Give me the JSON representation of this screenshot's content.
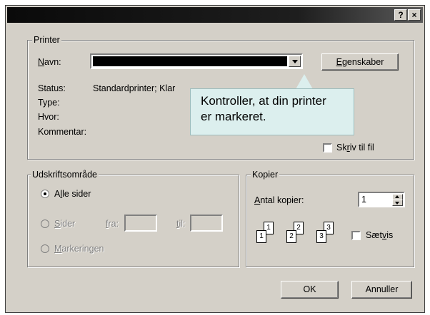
{
  "title_bar": {
    "help": "?",
    "close": "×"
  },
  "printer": {
    "group_label": "Printer",
    "name_label_pre": "",
    "name_label_u": "N",
    "name_label_post": "avn:",
    "properties_pre": "",
    "properties_u": "E",
    "properties_post": "genskaber",
    "status_label": "Status:",
    "status_value": "Standardprinter; Klar",
    "type_label": "Type:",
    "where_label": "Hvor:",
    "comment_label": "Kommentar:",
    "print_to_file_pre": "Sk",
    "print_to_file_u": "r",
    "print_to_file_post": "iv til fil"
  },
  "callout": {
    "line1": "Kontroller, at din printer",
    "line2": "er markeret."
  },
  "print_range": {
    "group_label": "Udskriftsområde",
    "all_pre": "A",
    "all_u": "l",
    "all_post": "le sider",
    "pages_pre": "",
    "pages_u": "S",
    "pages_post": "ider",
    "from_pre": "",
    "from_u": "f",
    "from_post": "ra:",
    "to_pre": "",
    "to_u": "t",
    "to_post": "il:",
    "selection_pre": "",
    "selection_u": "M",
    "selection_post": "arkeringen",
    "selected": "all"
  },
  "copies": {
    "group_label": "Kopier",
    "count_pre": "",
    "count_u": "A",
    "count_post": "ntal kopier:",
    "count_value": "1",
    "collate_pre": "Sæt",
    "collate_u": "v",
    "collate_post": "is",
    "pages": [
      "1",
      "1",
      "2",
      "2",
      "3",
      "3"
    ]
  },
  "buttons": {
    "ok": "OK",
    "cancel": "Annuller"
  }
}
